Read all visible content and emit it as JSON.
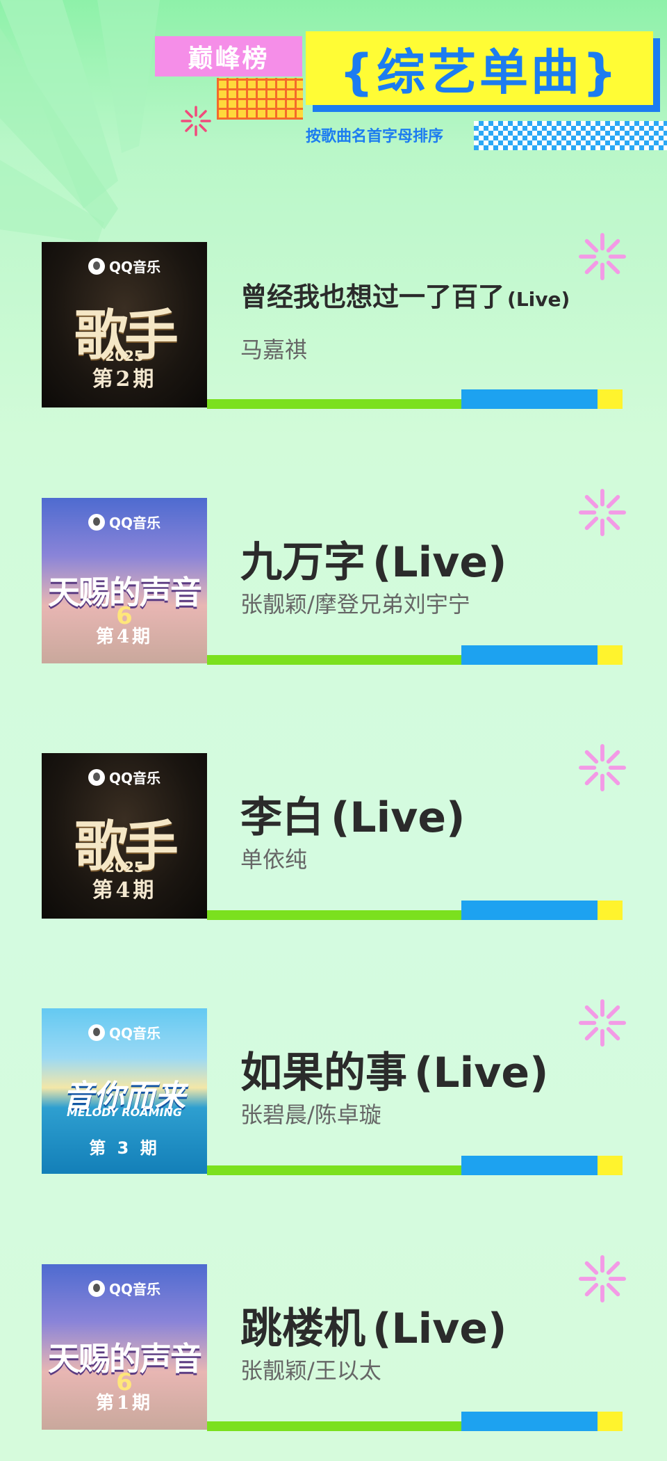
{
  "header": {
    "tag": "巅峰榜",
    "title": "{综艺单曲}",
    "subtitle": "按歌曲名首字母排序"
  },
  "songs": [
    {
      "title": "曾经我也想过一了百了",
      "suffix": "(Live)",
      "artist": "马嘉祺",
      "cover": {
        "brand": "QQ音乐",
        "logo": "歌手",
        "sub": "2025",
        "episode": "第2期",
        "style": "dark"
      }
    },
    {
      "title": "九万字",
      "suffix": "(Live)",
      "artist": "张靓颖/摩登兄弟刘宇宁",
      "cover": {
        "brand": "QQ音乐",
        "logo": "天赐的声音",
        "sub": "6",
        "episode": "第4期",
        "style": "purple"
      }
    },
    {
      "title": "李白",
      "suffix": "(Live)",
      "artist": "单依纯",
      "cover": {
        "brand": "QQ音乐",
        "logo": "歌手",
        "sub": "2025",
        "episode": "第4期",
        "style": "dark"
      }
    },
    {
      "title": "如果的事",
      "suffix": "(Live)",
      "artist": "张碧晨/陈卓璇",
      "cover": {
        "brand": "QQ音乐",
        "logo": "音你而来",
        "sub": "MELODY ROAMING",
        "episode": "第 3 期",
        "style": "sea"
      }
    },
    {
      "title": "跳楼机",
      "suffix": "(Live)",
      "artist": "张靓颖/王以太",
      "cover": {
        "brand": "QQ音乐",
        "logo": "天赐的声音",
        "sub": "6",
        "episode": "第1期",
        "style": "purple"
      }
    }
  ],
  "colors": {
    "accent_blue": "#1c7cf0",
    "accent_yellow": "#fffc35",
    "accent_pink": "#f58ee8",
    "bar_green": "#7be01e",
    "bar_blue": "#1da2f0",
    "bar_yellow": "#fff32d"
  },
  "icons": [
    "sparkle-icon",
    "qq-music-logo-icon"
  ]
}
